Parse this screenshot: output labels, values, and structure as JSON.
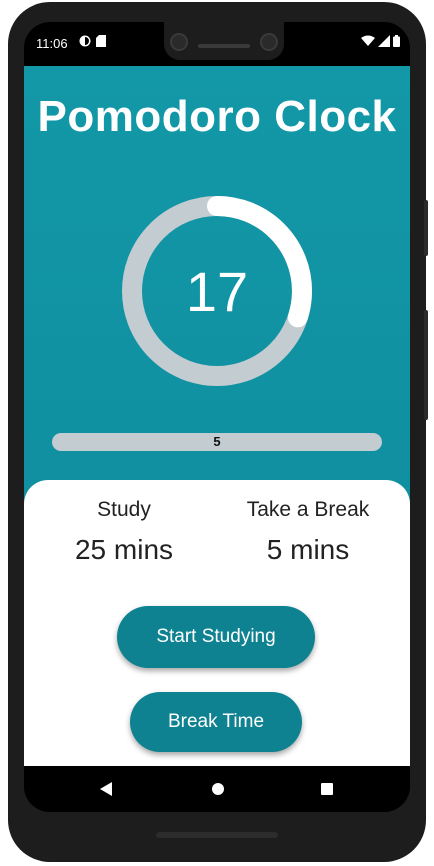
{
  "status_bar": {
    "time": "11:06"
  },
  "app": {
    "title": "Pomodoro Clock",
    "countdown": "17",
    "ring_progress_fraction": 0.3,
    "progress": {
      "label": "5"
    },
    "study": {
      "label": "Study",
      "value": "25 mins"
    },
    "break": {
      "label": "Take a Break",
      "value": "5 mins"
    },
    "buttons": {
      "start": "Start Studying",
      "break": "Break Time"
    }
  },
  "colors": {
    "background_teal": "#1398a8",
    "button_teal": "#0e8290",
    "ring_track": "#c3ccd1",
    "ring_progress": "#ffffff"
  },
  "icons": [
    "wifi-icon",
    "signal-icon",
    "battery-icon",
    "back-icon",
    "home-icon",
    "recents-icon"
  ]
}
